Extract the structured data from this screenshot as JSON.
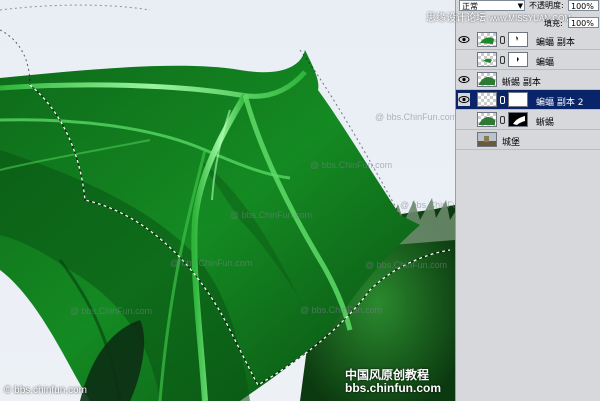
{
  "header": {
    "site_watermark": "思缘设计论坛",
    "site_url": "www.MISSYUAN.COM"
  },
  "layers_panel": {
    "blend_mode": "正常",
    "opacity_label": "不透明度:",
    "opacity_value": "100%",
    "fill_label": "填充:",
    "fill_value": "100%",
    "layers": [
      {
        "name": "蝙蝠 副本",
        "visible": true,
        "selected": false,
        "has_mask": true
      },
      {
        "name": "蝙蝠",
        "visible": false,
        "selected": false,
        "has_mask": true
      },
      {
        "name": "蜥蜴 副本",
        "visible": true,
        "selected": false,
        "has_mask": false
      },
      {
        "name": "蝙蝠 副本 2",
        "visible": true,
        "selected": true,
        "has_mask": true
      },
      {
        "name": "蜥蜴",
        "visible": false,
        "selected": false,
        "has_mask": true
      },
      {
        "name": "城堡",
        "visible": false,
        "selected": false,
        "has_mask": false
      }
    ]
  },
  "watermarks": {
    "chinfun_1": "@ bbs.ChinFun.com",
    "chinfun_2": "@ bbs.ChinFun.com",
    "chinfun_3": "@ bbs.ChinFun.com",
    "chinfun_4": "@ bbs.ChinFun.com",
    "chinfun_5": "@ bbs.ChinFun.com",
    "chinfun_6": "@ bbs.ChinFun.com",
    "chinfun_7": "@ bbs.ChinFun.com",
    "chinfun_8": "@ bbs.ChinFun.com",
    "footer_cn": "中国风原创教程",
    "footer_url": "bbs.chinfun.com",
    "corner": "bbs.chinfun.com"
  },
  "colors": {
    "wing_dark": "#0b5a16",
    "wing_mid": "#1f9a2c",
    "wing_light": "#6ff07a",
    "selection_highlight": "#0a246a"
  }
}
